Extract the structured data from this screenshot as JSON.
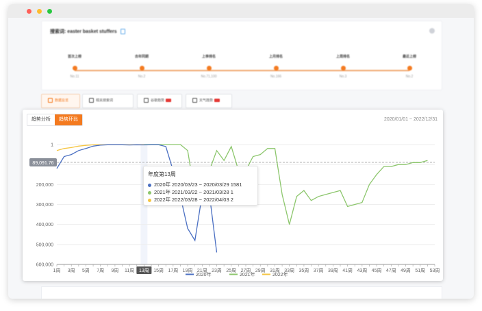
{
  "search": {
    "keyword_label": "搜索词:",
    "keyword": "easter basket stuffers"
  },
  "timeline": [
    {
      "title": "首次上榜",
      "value": "No.11"
    },
    {
      "title": "去年同期",
      "value": "No.2"
    },
    {
      "title": "上季排名",
      "value": "No.71,100"
    },
    {
      "title": "上月排名",
      "value": "No.166"
    },
    {
      "title": "上周排名",
      "value": "No.3"
    },
    {
      "title": "最近上榜",
      "value": "No.2"
    }
  ],
  "tabs": [
    "数据总览",
    "相关搜索词",
    "谷歌趋势",
    "天气趋势"
  ],
  "chart_panel": {
    "mode_buttons": [
      "趋势分析",
      "趋势环比"
    ],
    "active_mode": "趋势环比",
    "date_range": "2020/01/01 ~ 2022/12/31",
    "reference_label": "89,091.76"
  },
  "tooltip": {
    "title": "年度第13周",
    "rows": [
      {
        "year": "2020年",
        "range": "2020/03/23 ~ 2020/03/29",
        "value": "1581",
        "color": "#4a6fc2"
      },
      {
        "year": "2021年",
        "range": "2021/03/22 ~ 2021/03/28",
        "value": "1",
        "color": "#8cc66c"
      },
      {
        "year": "2022年",
        "range": "2022/03/28 ~ 2022/04/03",
        "value": "2",
        "color": "#f5c542"
      }
    ]
  },
  "chart_data": {
    "type": "line",
    "x": [
      "1周",
      "2周",
      "3周",
      "4周",
      "5周",
      "6周",
      "7周",
      "8周",
      "9周",
      "10周",
      "11周",
      "12周",
      "13周",
      "14周",
      "15周",
      "16周",
      "17周",
      "18周",
      "19周",
      "20周",
      "21周",
      "22周",
      "23周",
      "24周",
      "25周",
      "26周",
      "27周",
      "28周",
      "29周",
      "30周",
      "31周",
      "32周",
      "33周",
      "34周",
      "35周",
      "36周",
      "37周",
      "38周",
      "39周",
      "40周",
      "41周",
      "42周",
      "43周",
      "44周",
      "45周",
      "46周",
      "47周",
      "48周",
      "49周",
      "50周",
      "51周",
      "52周",
      "53周"
    ],
    "x_tick_labels": [
      "1周",
      "3周",
      "5周",
      "7周",
      "9周",
      "11周",
      "13周",
      "15周",
      "17周",
      "19周",
      "21周",
      "23周",
      "25周",
      "27周",
      "29周",
      "31周",
      "33周",
      "35周",
      "37周",
      "39周",
      "41周",
      "43周",
      "45周",
      "47周",
      "49周",
      "51周",
      "53周"
    ],
    "highlighted_x": "13周",
    "y_tick_labels": [
      "1",
      "200,000",
      "300,000",
      "400,000",
      "500,000",
      "600,000"
    ],
    "y_range": [
      600000,
      1
    ],
    "y_reversed": true,
    "reference_line": 89091.76,
    "series": [
      {
        "name": "2020年",
        "color": "#4a6fc2",
        "values": [
          120000,
          60000,
          50000,
          30000,
          20000,
          8000,
          3000,
          1000,
          1000,
          1000,
          2000,
          1000,
          1581,
          1000,
          1000,
          10000,
          130000,
          260000,
          420000,
          480000,
          250000,
          250000,
          540000,
          null,
          null,
          null,
          null,
          null,
          null,
          null,
          null,
          null,
          null,
          null,
          null,
          null,
          null,
          null,
          null,
          null,
          null,
          null,
          null,
          null,
          null,
          null,
          null,
          null,
          null,
          null,
          null,
          null,
          null
        ]
      },
      {
        "name": "2021年",
        "color": "#8cc66c",
        "values": [
          null,
          null,
          null,
          null,
          null,
          null,
          null,
          null,
          null,
          null,
          null,
          null,
          1,
          1,
          1,
          1,
          1,
          1,
          30000,
          250000,
          240000,
          130000,
          30000,
          80000,
          10000,
          130000,
          130000,
          60000,
          50000,
          20000,
          20000,
          250000,
          400000,
          260000,
          230000,
          280000,
          260000,
          250000,
          240000,
          230000,
          310000,
          300000,
          290000,
          200000,
          150000,
          110000,
          110000,
          100000,
          100000,
          90000,
          90000,
          80000,
          null
        ]
      },
      {
        "name": "2022年",
        "color": "#f5c542",
        "values": [
          30000,
          20000,
          15000,
          8000,
          4000,
          1500,
          1000,
          1000,
          1000,
          1000,
          1000,
          1000,
          2,
          null,
          null,
          null,
          null,
          null,
          null,
          null,
          null,
          null,
          null,
          null,
          null,
          null,
          null,
          null,
          null,
          null,
          null,
          null,
          null,
          null,
          null,
          null,
          null,
          null,
          null,
          null,
          null,
          null,
          null,
          null,
          null,
          null,
          null,
          null,
          null,
          null,
          null,
          null,
          null
        ]
      }
    ],
    "legend_position": "bottom"
  }
}
